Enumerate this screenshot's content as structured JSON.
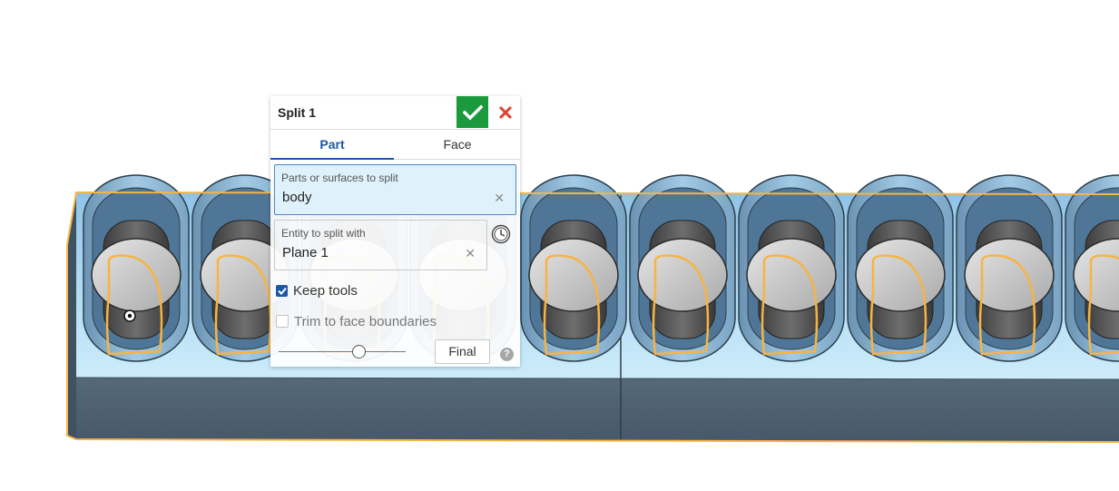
{
  "feature_dialog": {
    "title": "Split 1",
    "confirm_icon": "checkmark-icon",
    "cancel_icon": "close-icon",
    "tabs": [
      {
        "label": "Part",
        "active": true
      },
      {
        "label": "Face",
        "active": false
      }
    ],
    "parts_field": {
      "label": "Parts or surfaces to split",
      "value": "body"
    },
    "entity_field": {
      "label": "Entity to split with",
      "value": "Plane 1"
    },
    "history_icon": "clock-icon",
    "keep_tools": {
      "label": "Keep tools",
      "checked": true
    },
    "trim_faces": {
      "label": "Trim to face boundaries",
      "checked": false
    },
    "rollback_slider": {
      "position": 0.63
    },
    "final_button": "Final",
    "help_icon": "?"
  },
  "model": {
    "body_colors": {
      "top_face": "#a9d7f2",
      "side_face": "#4c5f70",
      "selection_edge": "#f6b443",
      "cap_face": "#c8c8c8"
    },
    "hole_count_visible": 10
  }
}
